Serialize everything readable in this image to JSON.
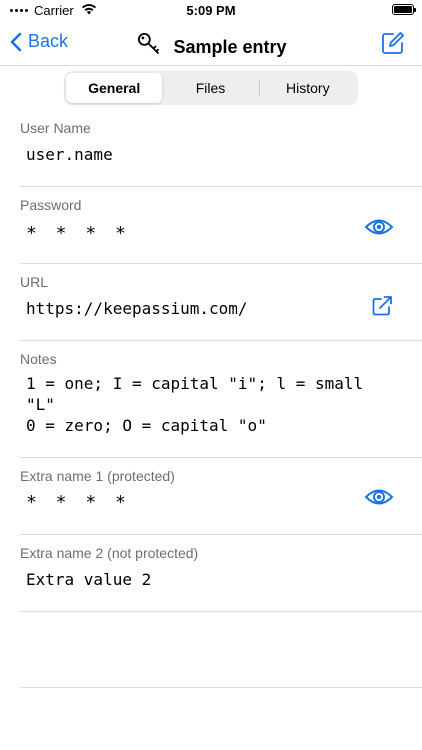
{
  "status_bar": {
    "carrier": "Carrier",
    "time": "5:09 PM"
  },
  "nav": {
    "back_label": "Back",
    "title": "Sample entry"
  },
  "tabs": [
    {
      "label": "General",
      "selected": true
    },
    {
      "label": "Files",
      "selected": false
    },
    {
      "label": "History",
      "selected": false
    }
  ],
  "fields": {
    "username": {
      "label": "User Name",
      "value": "user.name"
    },
    "password": {
      "label": "Password",
      "value": "* * * *"
    },
    "url": {
      "label": "URL",
      "value": "https://keepassium.com/"
    },
    "notes": {
      "label": "Notes",
      "value": "1 = one; I = capital \"i\"; l = small \"L\"\n0 = zero; O = capital \"o\""
    },
    "extra1": {
      "label": "Extra name 1 (protected)",
      "value": "* * * *"
    },
    "extra2": {
      "label": "Extra name 2 (not protected)",
      "value": "Extra value 2"
    }
  },
  "colors": {
    "accent": "#1a73e8",
    "separator": "#dcdcdc",
    "label": "#6e6e73"
  },
  "icons": [
    "key-icon",
    "edit-icon",
    "eye-icon",
    "external-link-icon",
    "chevron-left-icon",
    "wifi-icon",
    "battery-icon"
  ]
}
